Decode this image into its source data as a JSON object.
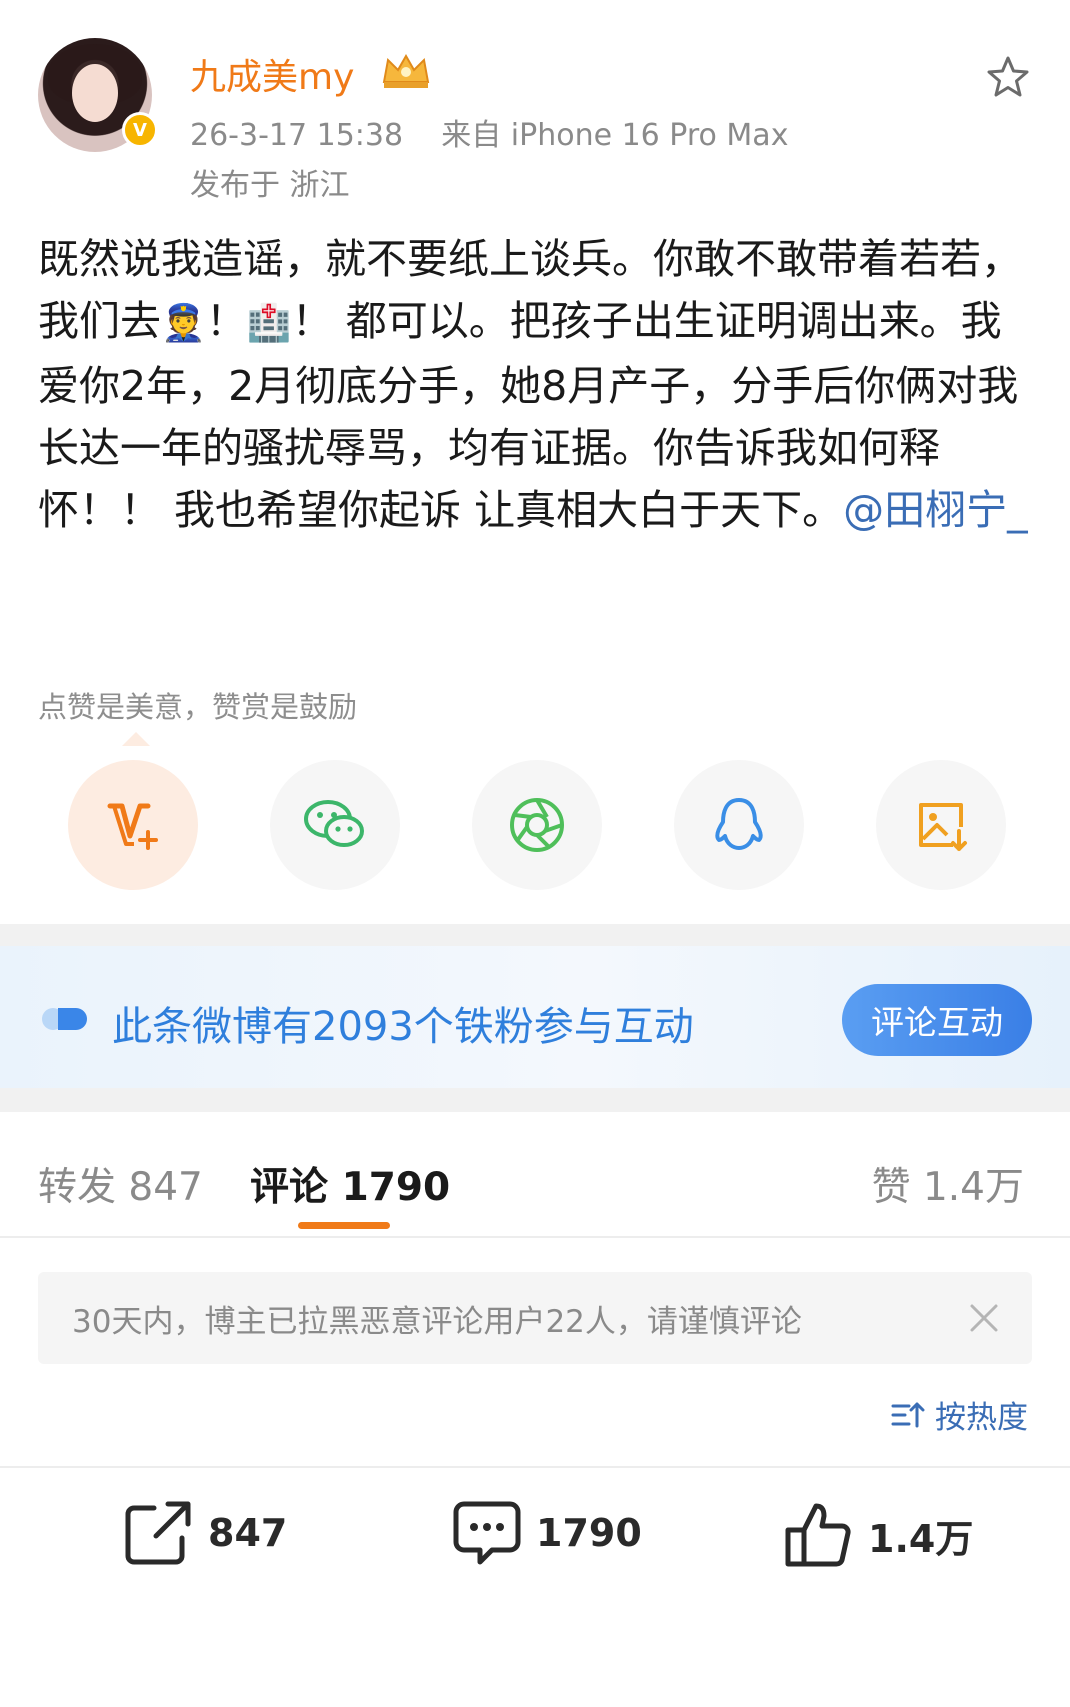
{
  "post": {
    "author": {
      "name": "九成美my",
      "verified_badge": "V",
      "badge_color": "#f7b500"
    },
    "timestamp": "26-3-17 15:38",
    "source": "来自 iPhone 16 Pro Max",
    "location": "发布于 浙江",
    "text_part1": "既然说我造谣，就不要纸上谈兵。你敢不敢带着若若，我们去",
    "emoji_police": "👮",
    "text_part2": "！",
    "emoji_hospital": "🏥",
    "text_part3": "！ 都可以。把孩子出生证明调出来。我爱你2年，2月彻底分手，她8月产子，分手后你俩对我长达一年的骚扰辱骂，均有证据。你告诉我如何释怀！！ 我也希望你起诉 让真相大白于天下。",
    "mention": "@田栩宁_"
  },
  "reward": {
    "hint": "点赞是美意，赞赏是鼓励",
    "share_icons": [
      "vplus-icon",
      "wechat-icon",
      "moments-icon",
      "qq-icon",
      "save-image-icon"
    ]
  },
  "fans": {
    "text": "此条微博有2093个铁粉参与互动",
    "button": "评论互动"
  },
  "tabs": {
    "repost": "转发 847",
    "comment": "评论 1790",
    "like": "赞 1.4万"
  },
  "notice": {
    "text": "30天内，博主已拉黑恶意评论用户22人，请谨慎评论"
  },
  "sort": {
    "label": "按热度"
  },
  "actions": {
    "repost_count": "847",
    "comment_count": "1790",
    "like_count": "1.4万"
  },
  "colors": {
    "accent_orange": "#f07a18",
    "link_blue": "#3a6db5",
    "fans_blue": "#2f7fdc"
  }
}
